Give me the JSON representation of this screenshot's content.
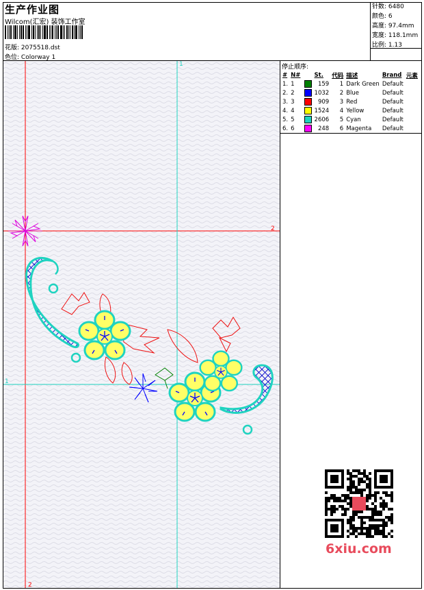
{
  "header": {
    "title": "生产作业图",
    "company": "Wilcom(汇宏) 装饰工作室",
    "design_label": "花版:",
    "design_value": "2075518.dst",
    "colorway_label": "色位:",
    "colorway_value": "Colorway 1"
  },
  "stats": {
    "stitches_label": "针数:",
    "stitches_value": "6480",
    "colors_label": "颜色:",
    "colors_value": "6",
    "height_label": "高度:",
    "height_value": "97.4mm",
    "width_label": "宽度:",
    "width_value": "118.1mm",
    "scale_label": "比例:",
    "scale_value": "1.13"
  },
  "canvas": {
    "marker_top": "1",
    "marker_right": "2",
    "marker_left": "1",
    "marker_bottom": "2"
  },
  "stop_sequence": {
    "title": "停止顺序:",
    "columns": [
      "#",
      "N#",
      "St.",
      "代码",
      "描述",
      "Brand",
      "元素"
    ],
    "rows": [
      {
        "idx": "1.",
        "n": "1",
        "color": "#008000",
        "st": "159",
        "code": "1",
        "desc": "Dark Green",
        "brand": "Default"
      },
      {
        "idx": "2.",
        "n": "2",
        "color": "#0000ff",
        "st": "1032",
        "code": "2",
        "desc": "Blue",
        "brand": "Default"
      },
      {
        "idx": "3.",
        "n": "3",
        "color": "#ff0000",
        "st": "909",
        "code": "3",
        "desc": "Red",
        "brand": "Default"
      },
      {
        "idx": "4.",
        "n": "4",
        "color": "#ffff00",
        "st": "1524",
        "code": "4",
        "desc": "Yellow",
        "brand": "Default"
      },
      {
        "idx": "5.",
        "n": "5",
        "color": "#1fd3c0",
        "st": "2606",
        "code": "5",
        "desc": "Cyan",
        "brand": "Default"
      },
      {
        "idx": "6.",
        "n": "6",
        "color": "#ff00ff",
        "st": "248",
        "code": "6",
        "desc": "Magenta",
        "brand": "Default"
      }
    ]
  },
  "watermark": {
    "brand": "6xiu.com"
  }
}
